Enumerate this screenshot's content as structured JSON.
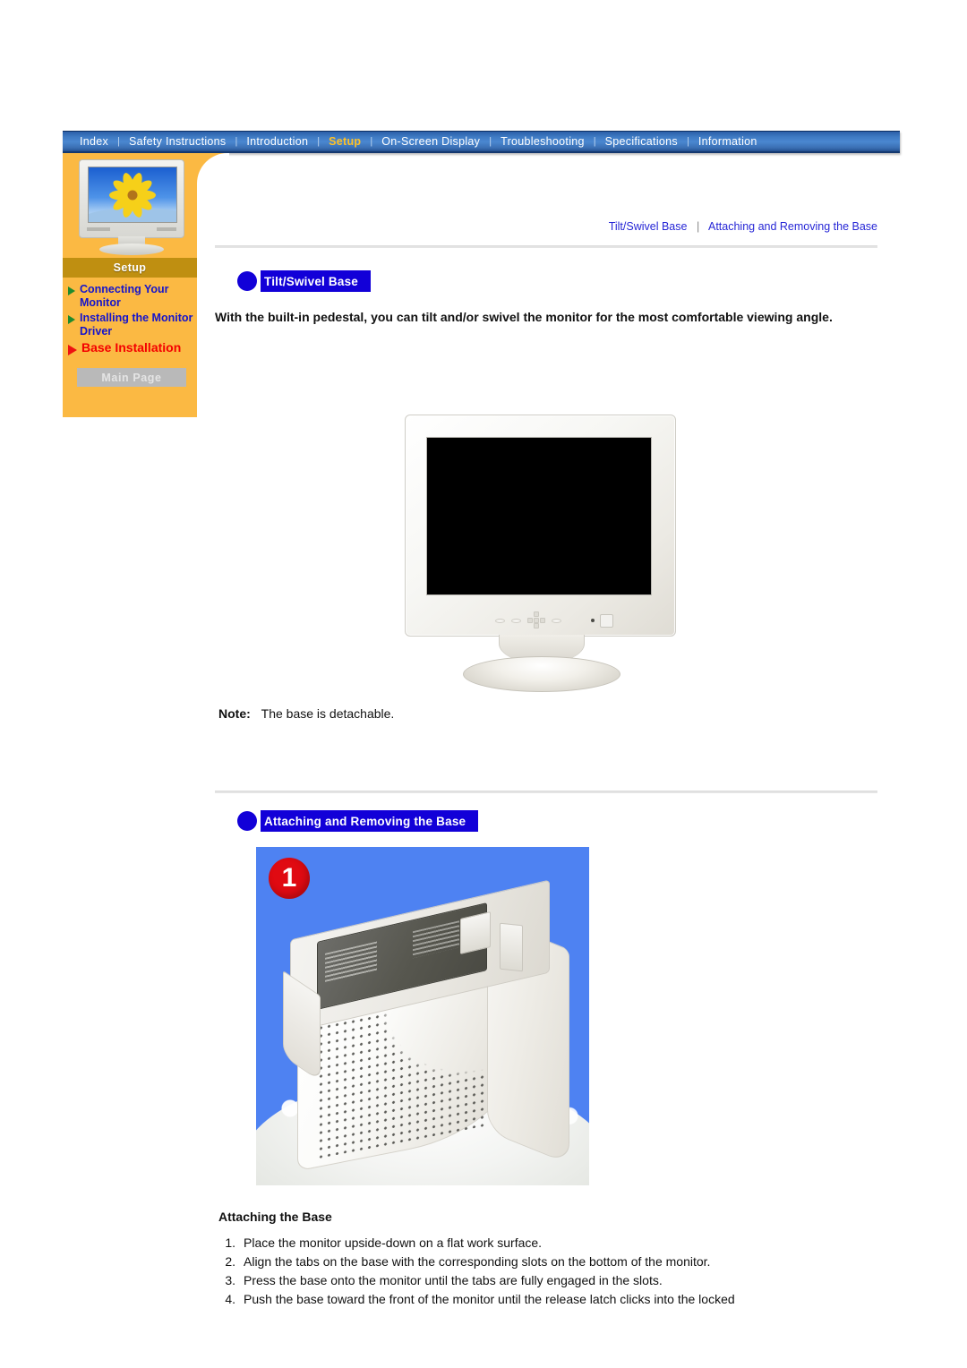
{
  "nav": {
    "items": [
      {
        "label": "Index",
        "active": false
      },
      {
        "label": "Safety Instructions",
        "active": false
      },
      {
        "label": "Introduction",
        "active": false
      },
      {
        "label": "Setup",
        "active": true
      },
      {
        "label": "On-Screen Display",
        "active": false
      },
      {
        "label": "Troubleshooting",
        "active": false
      },
      {
        "label": "Specifications",
        "active": false
      },
      {
        "label": "Information",
        "active": false
      }
    ],
    "separator": "|"
  },
  "sidebar": {
    "section_title": "Setup",
    "thumbnail_alt": "monitor-thumbnail-sunflower",
    "links": [
      {
        "label": "Connecting Your Monitor",
        "active": false
      },
      {
        "label": "Installing the Monitor Driver",
        "active": false
      },
      {
        "label": "Base Installation",
        "active": true
      }
    ],
    "main_page_button": "Main Page"
  },
  "breadcrumb": {
    "first": "Tilt/Swivel Base",
    "separator": "|",
    "second": "Attaching and Removing the Base"
  },
  "sections": {
    "tilt_swivel": {
      "heading": "Tilt/Swivel Base",
      "lead": "With the built-in pedestal, you can tilt and/or swivel the monitor for the most comfortable viewing angle.",
      "note_label": "Note:",
      "note_text": "The base is detachable."
    },
    "attaching": {
      "heading": "Attaching and Removing the Base",
      "photo_badge": "1",
      "sub_heading": "Attaching the Base",
      "steps": [
        {
          "num": "1.",
          "text": "Place the monitor upside-down on a flat work surface."
        },
        {
          "num": "2.",
          "text": "Align the tabs on the base with the corresponding slots on the bottom of the monitor."
        },
        {
          "num": "3.",
          "text": "Press the base onto the monitor until the tabs are fully engaged in the slots."
        },
        {
          "num": "4.",
          "text": "Push the base toward the front of the monitor until the release latch clicks into the locked"
        }
      ]
    }
  },
  "colors": {
    "nav_blue": "#3f7bc4",
    "nav_active": "#ffc125",
    "sidebar_orange": "#fbb943",
    "setup_bar": "#bf8f11",
    "banner_blue": "#1200d8",
    "link_blue": "#1414cc",
    "active_red": "#f40000",
    "badge_red": "#e00a12",
    "photo_bg_blue": "#4e82f2"
  }
}
